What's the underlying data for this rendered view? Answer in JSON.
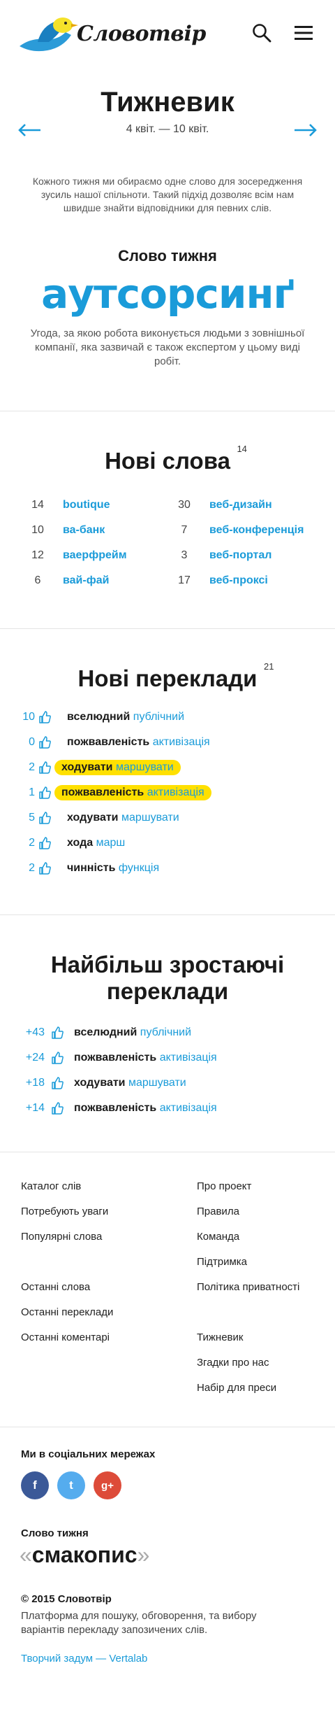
{
  "header": {
    "logo_text": "Словотвір",
    "search_icon": "search-icon",
    "menu_icon": "hamburger-menu-icon"
  },
  "weekly": {
    "title": "Тижневик",
    "dates": "4 квіт. — 10 квіт.",
    "intro": "Кожного тижня ми обираємо одне слово для зосередження зусиль нашої спільноти. Такий підхід дозволяє всім нам швидше знайти відповідники для певних слів."
  },
  "word_of_week": {
    "label": "Слово тижня",
    "word": "аутсорсинґ",
    "definition": "Угода, за якою робота виконується людьми з зовнішньої компанії, яка зазвичай є також експертом у цьому виді робіт."
  },
  "new_words": {
    "title": "Нові слова",
    "count": "14",
    "items": [
      {
        "count": "14",
        "word": "boutique"
      },
      {
        "count": "30",
        "word": "веб-дизайн"
      },
      {
        "count": "10",
        "word": "ва-банк"
      },
      {
        "count": "7",
        "word": "веб-конференція"
      },
      {
        "count": "12",
        "word": "ваерфрейм"
      },
      {
        "count": "3",
        "word": "веб-портал"
      },
      {
        "count": "6",
        "word": "вай-фай"
      },
      {
        "count": "17",
        "word": "веб-проксі"
      }
    ]
  },
  "new_translations": {
    "title": "Нові переклади",
    "count": "21",
    "items": [
      {
        "votes": "10",
        "source": "вселюдний",
        "target": "публічний",
        "highlight": false
      },
      {
        "votes": "0",
        "source": "пожвавленість",
        "target": "активізація",
        "highlight": false
      },
      {
        "votes": "2",
        "source": "ходувати",
        "target": "маршувати",
        "highlight": true
      },
      {
        "votes": "1",
        "source": "пожвавленість",
        "target": "активізація",
        "highlight": true
      },
      {
        "votes": "5",
        "source": "ходувати",
        "target": "маршувати",
        "highlight": false
      },
      {
        "votes": "2",
        "source": "хода",
        "target": "марш",
        "highlight": false
      },
      {
        "votes": "2",
        "source": "чинність",
        "target": "функція",
        "highlight": false
      }
    ]
  },
  "growing": {
    "title": "Найбільш зростаючі переклади",
    "items": [
      {
        "delta": "+43",
        "source": "вселюдний",
        "target": "публічний"
      },
      {
        "delta": "+24",
        "source": "пожвавленість",
        "target": "активізація"
      },
      {
        "delta": "+18",
        "source": "ходувати",
        "target": "маршувати"
      },
      {
        "delta": "+14",
        "source": "пожвавленість",
        "target": "активізація"
      }
    ]
  },
  "footer": {
    "left_links": [
      "Каталог слів",
      "Потребують уваги",
      "Популярні слова",
      "",
      "Останні слова",
      "Останні переклади",
      "Останні коментарі"
    ],
    "right_links": [
      "Про проект",
      "Правила",
      "Команда",
      "Підтримка",
      "Політика приватності",
      "",
      "Тижневик",
      "Згадки про нас",
      "Набір для преси"
    ],
    "social_label": "Ми в соціальних мережах",
    "social": [
      {
        "icon": "facebook-icon",
        "glyph": "f"
      },
      {
        "icon": "twitter-icon",
        "glyph": "t"
      },
      {
        "icon": "google-plus-icon",
        "glyph": "g+"
      }
    ],
    "word_label": "Слово тижня",
    "word_open": "«",
    "word": "смакопис",
    "word_close": "»",
    "copyright": "© 2015 Словотвір",
    "tagline": "Платформа для пошуку, обговорення, та вибору варіантів перекладу запозичених слів.",
    "credit": "Творчий задум — Vertalab"
  },
  "colors": {
    "accent": "#1a9bd9",
    "highlight": "#ffe000",
    "logo_yellow": "#f5e22a",
    "logo_blue": "#2b9bd8"
  }
}
